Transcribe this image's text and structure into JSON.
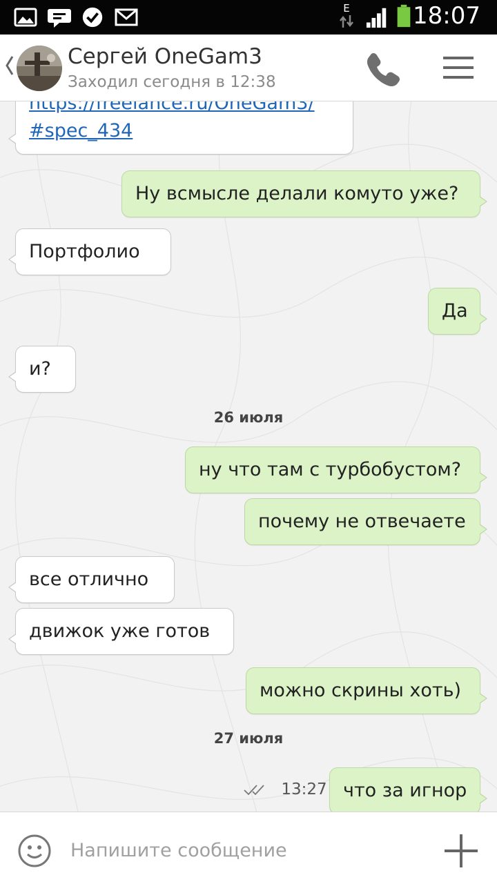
{
  "statusbar": {
    "time": "18:07",
    "network_label": "E",
    "icons": [
      "gallery-icon",
      "chat-icon",
      "check-app-icon",
      "mail-icon",
      "data-arrows-icon",
      "signal-icon",
      "battery-icon"
    ]
  },
  "header": {
    "contact_name": "Сергей OneGam3",
    "last_seen": "Заходил сегодня в 12:38",
    "icons": [
      "back-chevron-icon",
      "phone-icon",
      "menu-icon"
    ]
  },
  "messages": [
    {
      "dir": "in",
      "text": "https://freelance.ru/OneGam3/\n#spec_434",
      "lines": [
        "https://freelance.ru/OneGam3/",
        "#spec_434"
      ],
      "is_link": true
    },
    {
      "dir": "out",
      "text": "Ну всмысле делали комуто уже?"
    },
    {
      "dir": "in",
      "text": "Портфолио"
    },
    {
      "dir": "out",
      "text": "Да"
    },
    {
      "dir": "in",
      "text": "и?"
    },
    {
      "type": "date",
      "text": "26 июля"
    },
    {
      "dir": "out",
      "text": "ну что там с турбобустом?"
    },
    {
      "dir": "out",
      "text": "почему не отвечаете"
    },
    {
      "dir": "in",
      "text": "все отлично"
    },
    {
      "dir": "in",
      "text": "движок уже готов"
    },
    {
      "dir": "out",
      "text": "можно скрины хоть)"
    },
    {
      "type": "date",
      "text": "27 июля"
    },
    {
      "dir": "out",
      "text": "что за игнор",
      "time": "13:27",
      "read": true
    }
  ],
  "input": {
    "placeholder": "Напишите сообщение",
    "value": ""
  },
  "colors": {
    "outgoing_bubble": "#dcf3c8",
    "incoming_bubble": "#ffffff",
    "link": "#1f66b8",
    "statusbar": "#050505",
    "battery": "#7ac943"
  }
}
